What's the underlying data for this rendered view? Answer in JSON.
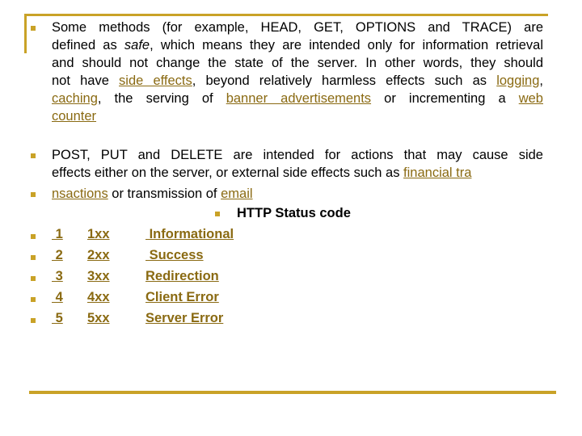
{
  "colors": {
    "accent": "#c9a227",
    "link": "#8a6a12",
    "text": "#000000"
  },
  "bullet_icon": "square-bullet",
  "paragraph1": {
    "lines": [
      [
        {
          "t": "Some methods (for example, HEAD, GET, OPTIONS and TRACE) are"
        }
      ],
      [
        {
          "t": "defined as "
        },
        {
          "t": "safe",
          "em": true
        },
        {
          "t": ", which means they are intended only for information retrieval"
        }
      ],
      [
        {
          "t": "and should not change the state of the server. In other words, they should"
        }
      ],
      [
        {
          "t": "not have "
        },
        {
          "t": "side effects",
          "link": true
        },
        {
          "t": ", beyond relatively harmless effects such as "
        },
        {
          "t": "logging",
          "link": true
        },
        {
          "t": ","
        }
      ],
      [
        {
          "t": "caching",
          "link": true
        },
        {
          "t": ", the serving of "
        },
        {
          "t": "banner advertisements",
          "link": true
        },
        {
          "t": " or incrementing a "
        },
        {
          "t": "web",
          "link": true
        }
      ],
      [
        {
          "t": "counter",
          "link": true
        }
      ]
    ]
  },
  "paragraph2": {
    "lines": [
      [
        {
          "t": "POST, PUT and DELETE are intended for actions that may cause side"
        }
      ],
      [
        {
          "t": "effects either on the server, or external side effects such as "
        },
        {
          "t": "financial tra",
          "link": true
        }
      ]
    ]
  },
  "paragraph3": {
    "lines": [
      [
        {
          "t": "nsactions",
          "link": true
        },
        {
          "t": " or transmission of "
        },
        {
          "t": "email",
          "link": true
        }
      ]
    ]
  },
  "status_heading": "HTTP Status code",
  "status_codes": [
    {
      "num": "1",
      "code": "1xx",
      "name": " Informational"
    },
    {
      "num": "2",
      "code": "2xx",
      "name": " Success"
    },
    {
      "num": "3",
      "code": "3xx",
      "name": "Redirection"
    },
    {
      "num": "4",
      "code": "4xx",
      "name": "Client Error"
    },
    {
      "num": "5",
      "code": "5xx",
      "name": "Server Error"
    }
  ]
}
